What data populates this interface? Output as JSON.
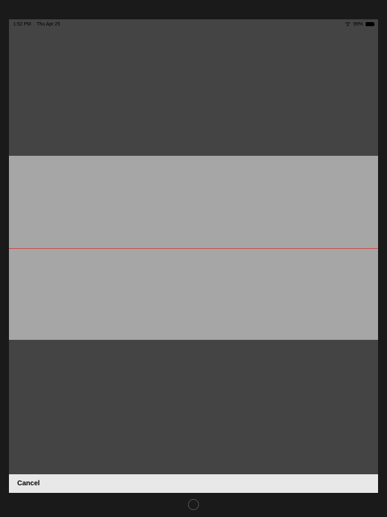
{
  "status_bar": {
    "time": "1:52 PM",
    "date": "Thu Apr 25",
    "battery_percent": "99%"
  },
  "bottom_bar": {
    "cancel_label": "Cancel"
  }
}
